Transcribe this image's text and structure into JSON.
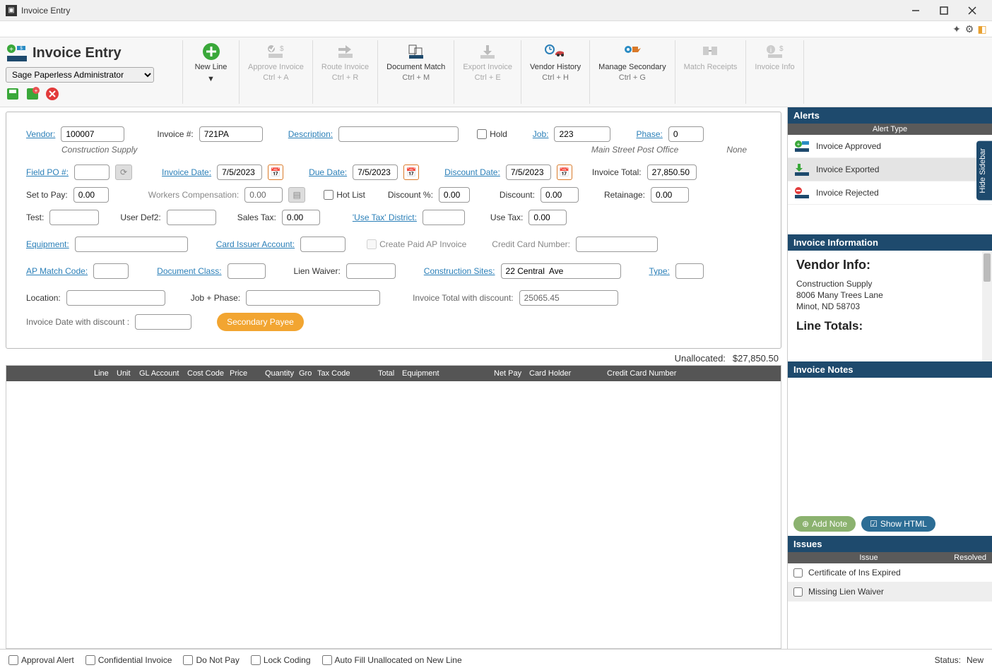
{
  "window": {
    "title": "Invoice Entry"
  },
  "header": {
    "title": "Invoice Entry",
    "admin_select": "Sage Paperless Administrator"
  },
  "ribbon": {
    "new_line": "New Line",
    "approve_invoice": "Approve Invoice",
    "approve_sc": "Ctrl + A",
    "route_invoice": "Route Invoice",
    "route_sc": "Ctrl + R",
    "doc_match": "Document Match",
    "doc_sc": "Ctrl + M",
    "export_invoice": "Export Invoice",
    "export_sc": "Ctrl + E",
    "vendor_history": "Vendor History",
    "vendor_sc": "Ctrl + H",
    "manage_secondary": "Manage Secondary",
    "manage_sc": "Ctrl + G",
    "match_receipts": "Match Receipts",
    "invoice_info": "Invoice Info"
  },
  "form": {
    "vendor_lbl": "Vendor:",
    "vendor": "100007",
    "vendor_name": "Construction Supply",
    "invoice_num_lbl": "Invoice #:",
    "invoice_num": "721PA",
    "description_lbl": "Description:",
    "description": "",
    "hold_lbl": "Hold",
    "job_lbl": "Job:",
    "job": "223",
    "job_name": "Main Street Post Office",
    "phase_lbl": "Phase:",
    "phase": "0",
    "phase_name": "None",
    "field_po_lbl": "Field PO #:",
    "field_po": "",
    "invoice_date_lbl": "Invoice Date:",
    "invoice_date": "7/5/2023",
    "due_date_lbl": "Due Date:",
    "due_date": "7/5/2023",
    "discount_date_lbl": "Discount Date:",
    "discount_date": "7/5/2023",
    "invoice_total_lbl": "Invoice Total:",
    "invoice_total": "27,850.50",
    "set_to_pay_lbl": "Set to Pay:",
    "set_to_pay": "0.00",
    "workers_comp_lbl": "Workers Compensation:",
    "workers_comp": "0.00",
    "hot_list_lbl": "Hot List",
    "discount_pct_lbl": "Discount %:",
    "discount_pct": "0.00",
    "discount_lbl": "Discount:",
    "discount": "0.00",
    "retainage_lbl": "Retainage:",
    "retainage": "0.00",
    "test_lbl": "Test:",
    "test": "",
    "userdef2_lbl": "User Def2:",
    "userdef2": "",
    "sales_tax_lbl": "Sales Tax:",
    "sales_tax": "0.00",
    "use_tax_district_lbl": "'Use Tax' District:",
    "use_tax_district": "",
    "use_tax_lbl": "Use Tax:",
    "use_tax": "0.00",
    "equipment_lbl": "Equipment:",
    "equipment": "",
    "card_issuer_lbl": "Card Issuer Account:",
    "card_issuer": "",
    "create_paid_ap_lbl": "Create Paid AP Invoice",
    "cc_number_lbl": "Credit Card Number:",
    "cc_number": "",
    "ap_match_lbl": "AP Match Code:",
    "ap_match": "",
    "doc_class_lbl": "Document Class:",
    "doc_class": "",
    "lien_waiver_lbl": "Lien Waiver:",
    "lien_waiver": "",
    "constr_sites_lbl": "Construction Sites:",
    "constr_sites": "22 Central  Ave",
    "type_lbl": "Type:",
    "type": "",
    "location_lbl": "Location:",
    "location": "",
    "job_phase_lbl": "Job + Phase:",
    "job_phase": "",
    "inv_total_disc_lbl": "Invoice Total with discount:",
    "inv_total_disc": "25065.45",
    "inv_date_disc_lbl": "Invoice Date with discount :",
    "inv_date_disc": "",
    "secondary_payee": "Secondary Payee"
  },
  "unallocated": {
    "label": "Unallocated:",
    "value": "$27,850.50"
  },
  "grid_cols": [
    "",
    "Line",
    "Unit",
    "GL Account",
    "Cost Code",
    "Price",
    "Quantity",
    "Gro",
    "Tax Code",
    "Total",
    "Equipment",
    "Net Pay",
    "Card Holder",
    "Credit Card Number"
  ],
  "alerts": {
    "title": "Alerts",
    "col": "Alert Type",
    "items": [
      "Invoice Approved",
      "Invoice Exported",
      "Invoice Rejected"
    ]
  },
  "info": {
    "title": "Invoice Information",
    "vendor_hdr": "Vendor Info:",
    "vendor_line1": "Construction Supply",
    "vendor_line2": "8006 Many Trees Lane",
    "vendor_line3": "Minot, ND 58703",
    "line_totals_hdr": "Line Totals:"
  },
  "notes": {
    "title": "Invoice Notes",
    "add": "Add Note",
    "show_html": "Show HTML"
  },
  "issues": {
    "title": "Issues",
    "col_issue": "Issue",
    "col_resolved": "Resolved",
    "items": [
      "Certificate of Ins Expired",
      "Missing Lien Waiver"
    ]
  },
  "sidebar_tab": "Hide Sidebar",
  "status": {
    "approval_alert": "Approval Alert",
    "confidential": "Confidential Invoice",
    "do_not_pay": "Do Not Pay",
    "lock_coding": "Lock Coding",
    "auto_fill": "Auto Fill Unallocated on New Line",
    "status_lbl": "Status:",
    "status_val": "New"
  }
}
